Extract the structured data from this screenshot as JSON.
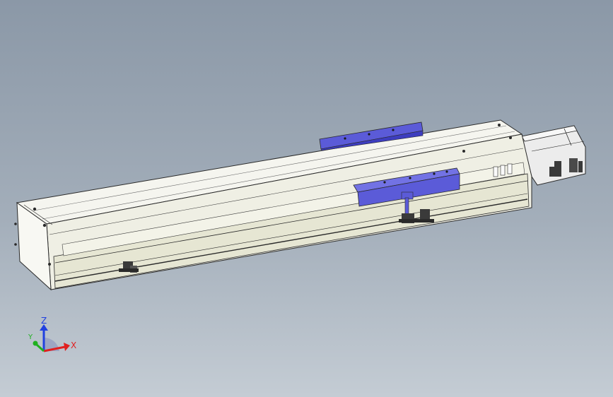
{
  "viewport": {
    "background_top": "#8b98a7",
    "background_bottom": "#c4ccd4"
  },
  "model": {
    "colors": {
      "body": "#f3f3ec",
      "body_shade": "#e6e6d6",
      "outline": "#2a2a2a",
      "carriage": "#5b5bd8",
      "carriage_dark": "#3d3dbf",
      "motor": "#ececec",
      "bracket": "#3a3a3a"
    }
  },
  "triad": {
    "x_label": "X",
    "y_label": "Y",
    "z_label": "Z",
    "x_color": "#e02020",
    "y_color": "#20b020",
    "z_color": "#2040e0"
  }
}
